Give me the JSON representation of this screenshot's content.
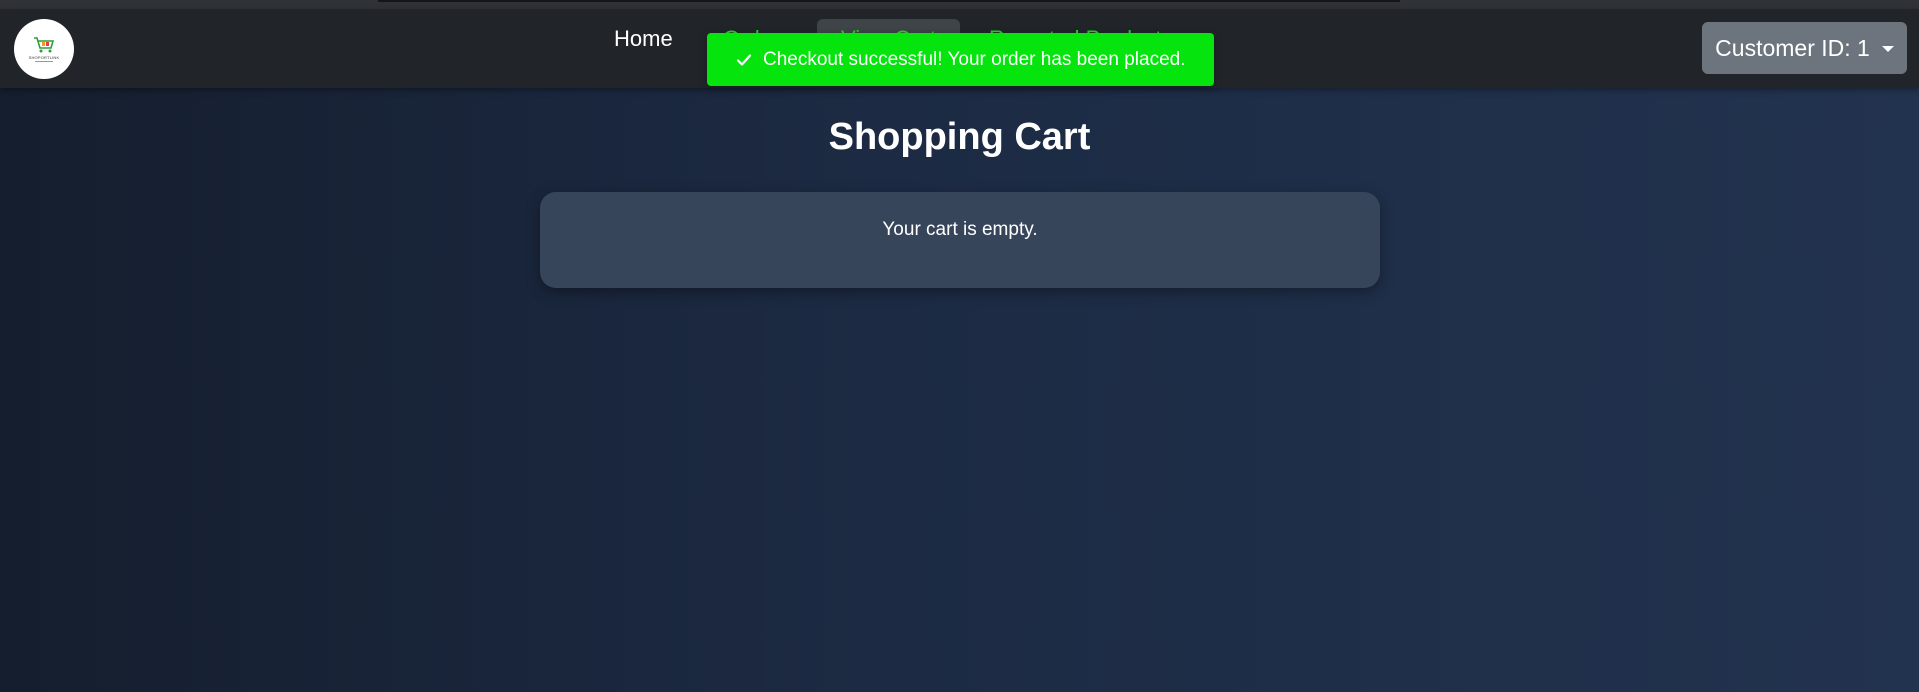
{
  "nav": {
    "logo_text": "SHOPORTLINK",
    "links": [
      {
        "label": "Home"
      },
      {
        "label": "Orders"
      },
      {
        "label": "View Cart"
      },
      {
        "label": "Reported Products"
      }
    ],
    "customer_button": "Customer ID: 1"
  },
  "toast": {
    "message": "Checkout successful! Your order has been placed.",
    "icon": "check-icon",
    "color": "#05e40c"
  },
  "page": {
    "title": "Shopping Cart",
    "empty_message": "Your cart is empty."
  },
  "colors": {
    "navbar": "#212529",
    "accent_green": "#1fd822",
    "dropdown_button": "#6c757d",
    "card": "#364559"
  }
}
